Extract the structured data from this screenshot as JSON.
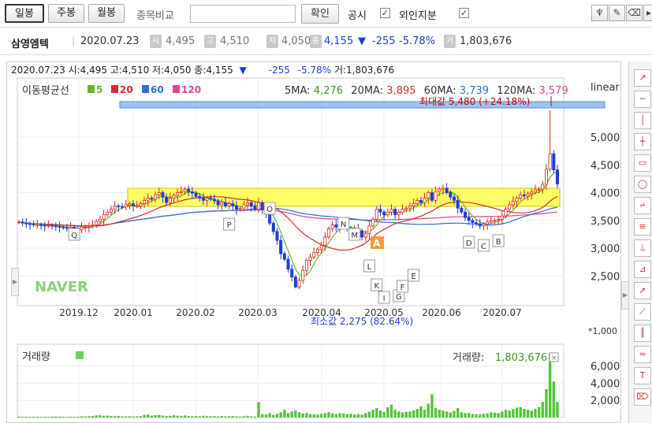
{
  "toolbar": {
    "period_buttons": [
      "일봉",
      "주봉",
      "월봉"
    ],
    "selected_period": "일봉",
    "compare_label": "종목비교",
    "compare_input_value": "",
    "confirm_label": "확인",
    "disclosure_label": "공시",
    "foreign_label": "외인지분",
    "disclosure_checked": true,
    "foreign_checked": true,
    "tool_icons": [
      "pin-icon",
      "pen-icon",
      "eraser-icon",
      "scroll-icon"
    ]
  },
  "infobar": {
    "name": "삼영엠텍",
    "date": "2020.07.23",
    "open_label": "시",
    "open": "4,495",
    "high_label": "고",
    "high": "4,510",
    "low_label": "저",
    "low": "4,050",
    "close_label": "종",
    "close": "4,155",
    "change_arrow": "▼",
    "change": "-255",
    "change_pct": "-5.78%",
    "volume_label": "거",
    "volume": "1,803,676",
    "down_color": "#1f3ed8"
  },
  "chart_top": {
    "date_line": "2020.07.23 시:4,495 고:4,510 저:4,050 종:4,155",
    "arrow": "▼",
    "change": "-255",
    "change_pct": "-5.78%",
    "volume_text": "거:1,803,676",
    "ma_legend_title": "이동평균선",
    "ma_legend": [
      {
        "label": "5",
        "color": "#6ab52e"
      },
      {
        "label": "20",
        "color": "#d62b2b"
      },
      {
        "label": "60",
        "color": "#2b6fd6"
      },
      {
        "label": "120",
        "color": "#e0448f"
      }
    ],
    "ma_values": [
      {
        "label": "5MA:",
        "value": "4,276",
        "color": "#3e9a1c"
      },
      {
        "label": "20MA:",
        "value": "3,895",
        "color": "#d62b2b"
      },
      {
        "label": "60MA:",
        "value": "3,739",
        "color": "#2b6fd6"
      },
      {
        "label": "120MA:",
        "value": "3,579",
        "color": "#e0448f"
      }
    ],
    "scale_mode": "linear",
    "max_label": "최대값 5,480 (+24.18%)",
    "min_label": "최소값 2,275 (82.64%)",
    "watermark": "NAVER",
    "pattern_badge": "A"
  },
  "chart_data": [
    {
      "type": "candlestick",
      "y_ticks": [
        5000,
        4500,
        4000,
        3500,
        3000,
        2500
      ],
      "ylim": [
        2000,
        5500
      ],
      "x_ticks": [
        "2019.12",
        "2020.01",
        "2020.02",
        "2020.03",
        "2020.04",
        "2020.05",
        "2020.06",
        "2020.07"
      ],
      "last_close": 4155,
      "max_value": 5480,
      "min_value": 2275,
      "ma": {
        "5": 4276,
        "20": 3895,
        "60": 3739,
        "120": 3579
      },
      "closes": [
        3470,
        3450,
        3440,
        3430,
        3420,
        3420,
        3410,
        3400,
        3410,
        3400,
        3390,
        3380,
        3370,
        3360,
        3380,
        3350,
        3330,
        3380,
        3380,
        3400,
        3420,
        3480,
        3520,
        3600,
        3650,
        3700,
        3760,
        3750,
        3740,
        3780,
        3800,
        3760,
        3760,
        3800,
        3860,
        3900,
        3880,
        3960,
        4000,
        3920,
        3820,
        3900,
        3950,
        4000,
        4020,
        4060,
        4010,
        3990,
        3930,
        3900,
        3860,
        3900,
        3880,
        3850,
        3780,
        3820,
        3760,
        3800,
        3760,
        3700,
        3720,
        3780,
        3820,
        3760,
        3700,
        3820,
        3700,
        3640,
        3450,
        3300,
        3140,
        2900,
        2800,
        2620,
        2480,
        2300,
        2420,
        2600,
        2780,
        2840,
        2920,
        2980,
        3050,
        3200,
        3350,
        3420,
        3380,
        3400,
        3420,
        3360,
        3300,
        3350,
        3310,
        3200,
        3260,
        3400,
        3520,
        3700,
        3650,
        3600,
        3650,
        3700,
        3600,
        3640,
        3700,
        3720,
        3760,
        3800,
        3860,
        3820,
        3900,
        4000,
        3860,
        4020,
        4060,
        4080,
        4000,
        3920,
        3860,
        3720,
        3650,
        3550,
        3500,
        3460,
        3440,
        3400,
        3430,
        3470,
        3490,
        3500,
        3520,
        3580,
        3700,
        3780,
        3840,
        3900,
        3960,
        3940,
        3980,
        4010,
        4050,
        4060,
        4150,
        4420,
        4700,
        4410,
        4155
      ],
      "annotations": [
        "Q",
        "P",
        "O",
        "N",
        "M",
        "L",
        "K",
        "I",
        "G",
        "F",
        "E",
        "D",
        "C",
        "B"
      ]
    },
    {
      "type": "bar",
      "title": "거래량",
      "value_label": "거래량:",
      "value": "1,803,676",
      "unit": "*1,000",
      "y_ticks": [
        6000,
        4000,
        2000
      ],
      "ylim": [
        0,
        7800
      ],
      "last_volume_k": 1804,
      "volumes_k": [
        110,
        90,
        100,
        80,
        95,
        100,
        85,
        90,
        80,
        95,
        110,
        100,
        90,
        80,
        100,
        85,
        95,
        140,
        120,
        160,
        180,
        250,
        260,
        200,
        220,
        180,
        160,
        190,
        140,
        130,
        150,
        120,
        140,
        160,
        300,
        350,
        220,
        280,
        300,
        220,
        180,
        200,
        260,
        210,
        190,
        230,
        170,
        160,
        180,
        140,
        200,
        160,
        150,
        170,
        130,
        180,
        140,
        160,
        170,
        140,
        120,
        150,
        200,
        130,
        110,
        1800,
        400,
        350,
        500,
        300,
        420,
        600,
        900,
        500,
        700,
        800,
        600,
        480,
        520,
        400,
        380,
        350,
        420,
        500,
        620,
        480,
        400,
        500,
        450,
        380,
        420,
        350,
        400,
        330,
        500,
        680,
        900,
        1100,
        800,
        650,
        1200,
        1500,
        900,
        700,
        600,
        650,
        700,
        820,
        1000,
        1300,
        900,
        1600,
        2700,
        1100,
        900,
        800,
        700,
        600,
        750,
        1100,
        600,
        500,
        520,
        400,
        380,
        350,
        420,
        480,
        600,
        560,
        520,
        680,
        900,
        800,
        1000,
        1150,
        1200,
        1000,
        900,
        800,
        1000,
        1200,
        1800,
        3300,
        7400,
        4200,
        1804
      ]
    }
  ],
  "right_panel_icons": [
    "line-tool-icon",
    "hline-tool-icon",
    "vline-tool-icon",
    "cross-tool-icon",
    "rect-tool-icon",
    "circle-tool-icon",
    "fibo-tool-icon",
    "grid-tool-icon",
    "ruler-tool-icon",
    "angle-tool-icon",
    "arrow-tool-icon",
    "trend-tool-icon",
    "bar-tool-icon",
    "wave-tool-icon",
    "text-tool-icon",
    "delete-tool-icon"
  ]
}
